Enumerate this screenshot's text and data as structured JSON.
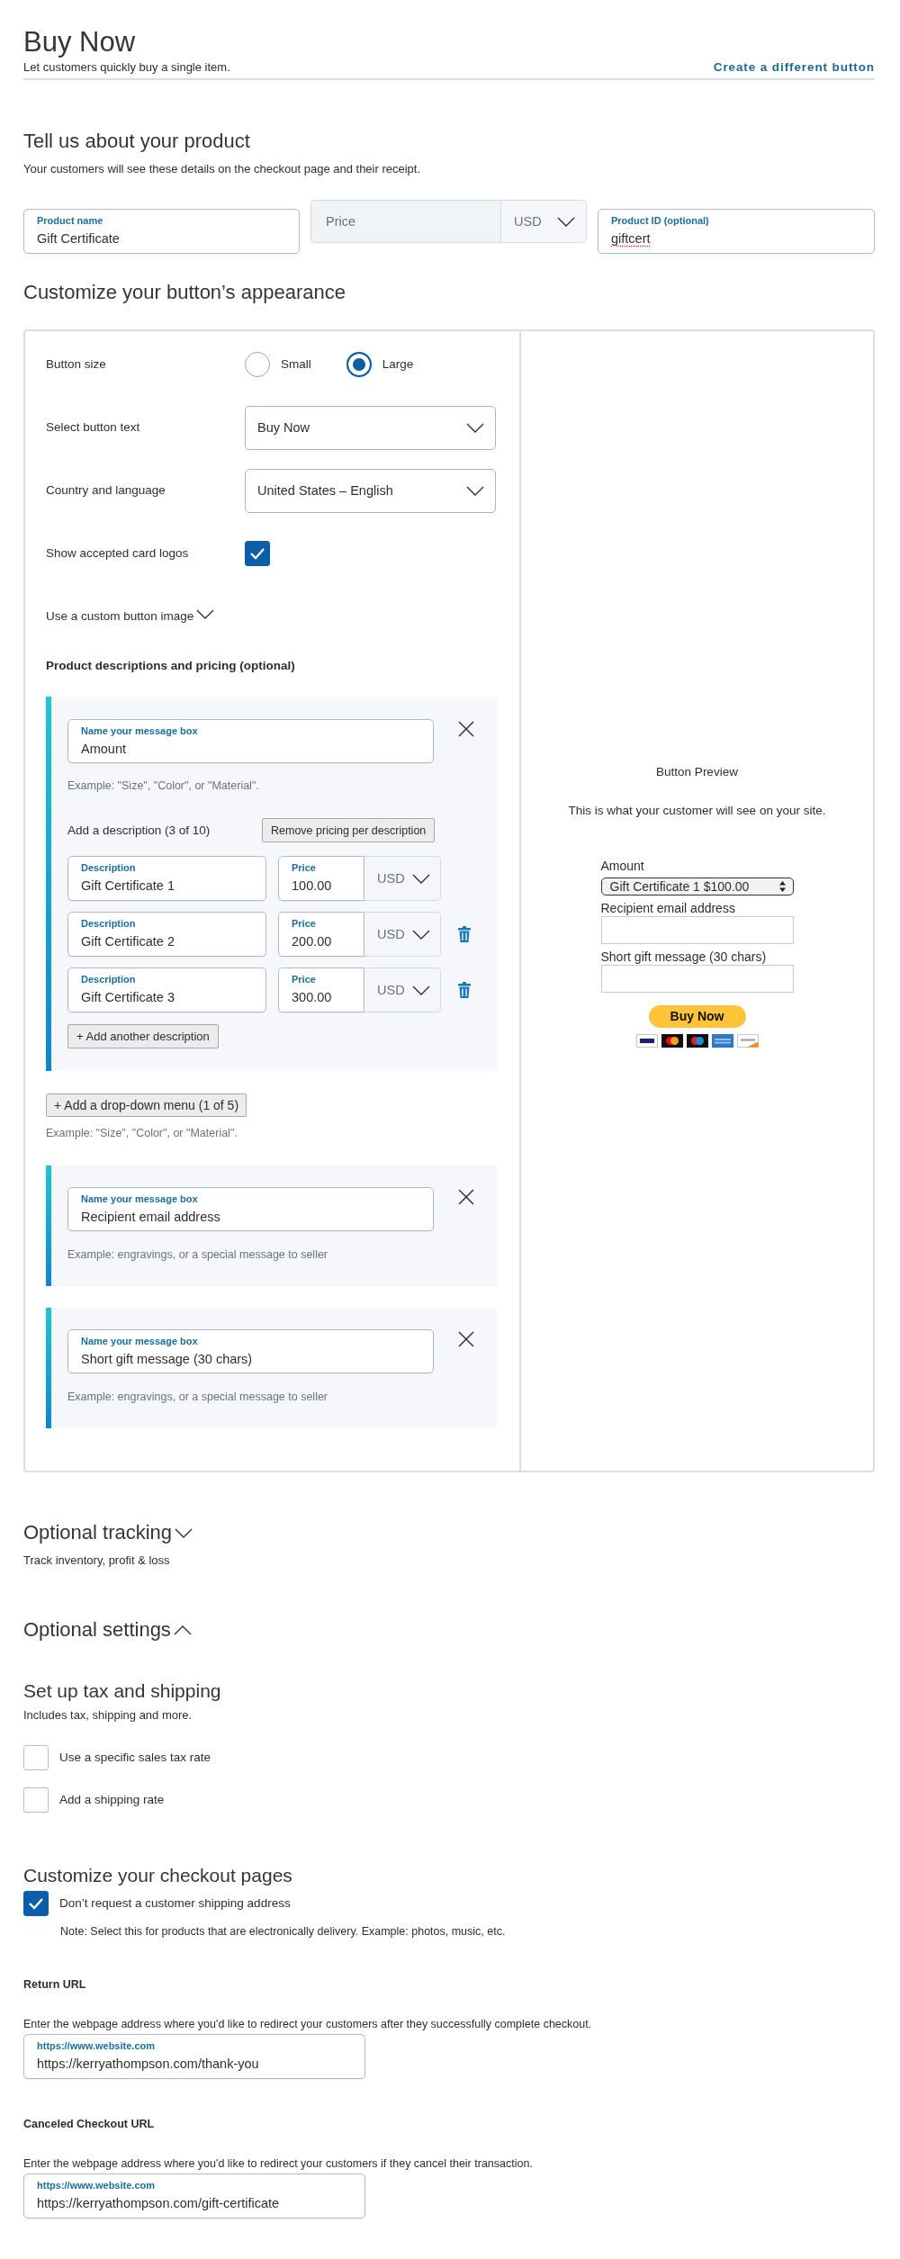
{
  "header": {
    "title": "Buy Now",
    "subtitle": "Let customers quickly buy a single item.",
    "link": "Create a different button"
  },
  "product": {
    "title": "Tell us about your product",
    "description": "Your customers will see these details on the checkout page and their receipt.",
    "fields": [
      {
        "kind": "text",
        "label": "Product name",
        "value": "Gift Certificate",
        "disabled": false,
        "misspelled": false
      },
      {
        "kind": "price",
        "placeholder": "Price",
        "currency": "USD",
        "disabled": true,
        "misspelled": false
      },
      {
        "kind": "text",
        "label": "Product ID (optional)",
        "value": "giftcert",
        "disabled": false,
        "misspelled": true
      }
    ]
  },
  "appearance": {
    "title": "Customize your button’s appearance",
    "settings": [
      {
        "kind": "radio",
        "label": "Button size",
        "options": [
          {
            "label": "Small",
            "selected": false
          },
          {
            "label": "Large",
            "selected": true
          }
        ]
      },
      {
        "kind": "select",
        "label": "Select button text",
        "value": "Buy Now"
      },
      {
        "kind": "select",
        "label": "Country and language",
        "value": "United States – English"
      },
      {
        "kind": "checkbox",
        "label": "Show accepted card logos",
        "checked": true
      },
      {
        "kind": "expander",
        "label": "Use a custom button image",
        "expanded": false
      }
    ],
    "pricing_title": "Product descriptions and pricing (optional)",
    "dropdown_menus": [
      {
        "field_label": "Name your message box",
        "value": "Amount",
        "hint": "Example: \"Size\", \"Color\", or \"Material\".",
        "count_label": "Add a description (3 of 10)",
        "remove_button": "Remove pricing per description",
        "rows": [
          {
            "description_label": "Description",
            "description": "Gift Certificate 1",
            "price_label": "Price",
            "price": "100.00",
            "currency": "USD",
            "deletable": false
          },
          {
            "description_label": "Description",
            "description": "Gift Certificate 2",
            "price_label": "Price",
            "price": "200.00",
            "currency": "USD",
            "deletable": true
          },
          {
            "description_label": "Description",
            "description": "Gift Certificate 3",
            "price_label": "Price",
            "price": "300.00",
            "currency": "USD",
            "deletable": true
          }
        ],
        "add_button": "+ Add another description"
      }
    ],
    "add_menu_button": "+ Add a drop-down menu (1 of 5)",
    "add_menu_hint": "Example: \"Size\", \"Color\", or \"Material\".",
    "text_boxes": [
      {
        "field_label": "Name your message box",
        "value": "Recipient email address",
        "hint": "Example: engravings, or a special message to seller"
      },
      {
        "field_label": "Name your message box",
        "value": "Short gift message (30 chars)",
        "hint": "Example: engravings, or a special message to seller"
      }
    ],
    "preview": {
      "title": "Button Preview",
      "description": "This is what your customer will see on your site.",
      "fields": [
        {
          "kind": "select",
          "label": "Amount",
          "value": "Gift Certificate 1 $100.00"
        },
        {
          "kind": "text",
          "label": "Recipient email address"
        },
        {
          "kind": "text",
          "label": "Short gift message (30 chars)"
        }
      ],
      "button": "Buy Now"
    }
  },
  "tracking": {
    "title": "Optional tracking",
    "expanded": false,
    "description": "Track inventory, profit & loss"
  },
  "settings": {
    "title": "Optional settings",
    "expanded": true
  },
  "tax_shipping": {
    "title": "Set up tax and shipping",
    "description": "Includes tax, shipping and more.",
    "options": [
      {
        "label": "Use a specific sales tax rate",
        "checked": false
      },
      {
        "label": "Add a shipping rate",
        "checked": false
      }
    ]
  },
  "checkout": {
    "title": "Customize your checkout pages",
    "options": [
      {
        "label": "Don’t request a customer shipping address",
        "checked": true,
        "note": "Note: Select this for products that are electronically delivery. Example: photos, music, etc."
      }
    ],
    "url_fields": [
      {
        "title": "Return URL",
        "description": "Enter the webpage address where you'd like to redirect your customers after they successfully complete checkout.",
        "label": "https://www.website.com",
        "value": "https://kerryathompson.com/thank-you"
      },
      {
        "title": "Canceled Checkout URL",
        "description": "Enter the webpage address where you'd like to redirect your customers if they cancel their transaction.",
        "label": "https://www.website.com",
        "value": "https://kerryathompson.com/gift-certificate"
      }
    ]
  }
}
